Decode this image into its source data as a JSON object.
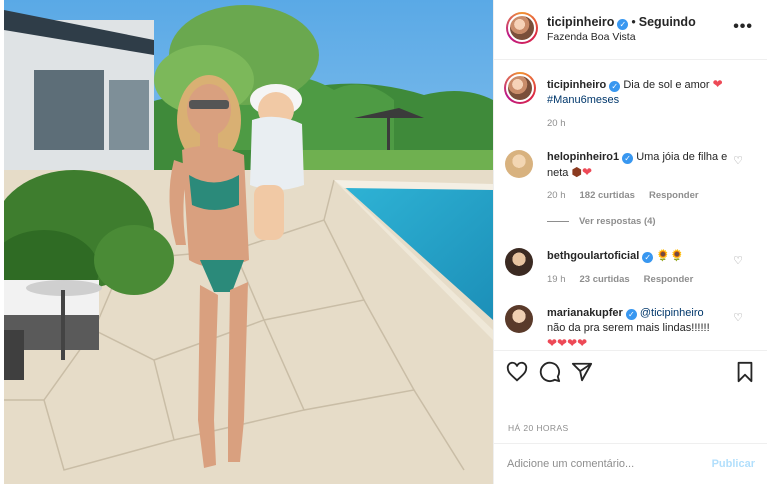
{
  "post": {
    "username": "ticipinheiro",
    "separator": "•",
    "follow_status": "Seguindo",
    "location": "Fazenda Boa Vista",
    "more_icon": "more-horizontal-icon",
    "caption_text": "Dia de sol e amor",
    "caption_hashtag": "#Manu6meses",
    "caption_time": "20 h",
    "timestamp": "HÁ 20 HORAS"
  },
  "comments": [
    {
      "username": "helopinheiro1",
      "text": "Uma jóia de filha e neta",
      "time": "20 h",
      "likes": "182 curtidas",
      "reply": "Responder",
      "view_replies": "Ver respostas (4)"
    },
    {
      "username": "bethgoulartoficial",
      "text": "🌻🌻",
      "time": "19 h",
      "likes": "23 curtidas",
      "reply": "Responder"
    },
    {
      "username": "marianakupfer",
      "mention": "@ticipinheiro",
      "text": "não da pra serem mais lindas!!!!!!",
      "hearts": "❤❤❤❤"
    }
  ],
  "composer": {
    "placeholder": "Adicione um comentário...",
    "publish_label": "Publicar"
  },
  "colors": {
    "link": "#00376b",
    "verified": "#3897f0",
    "heart": "#ed4956",
    "muted": "#8e8e8e",
    "publish_disabled": "#b2dffc"
  }
}
